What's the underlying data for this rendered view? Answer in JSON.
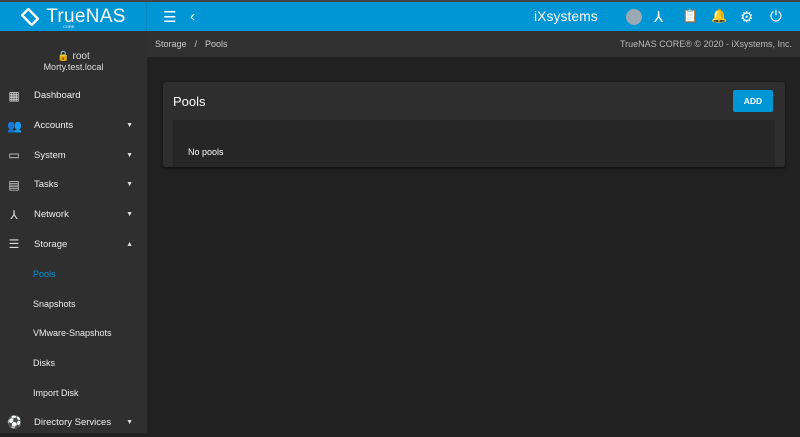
{
  "topbar": {
    "brand": "TrueNAS",
    "brand_sub": "CORE",
    "vendor_logo": "iXsystems",
    "icons": [
      "menu-icon",
      "chevron-left-icon",
      "truecommand-icon",
      "network-icon",
      "tasks-clipboard-icon",
      "bell-icon",
      "gear-icon",
      "power-icon"
    ]
  },
  "user": {
    "name": "root",
    "host": "Morty.test.local"
  },
  "sidebar": {
    "items": [
      {
        "label": "Dashboard",
        "icon": "▦"
      },
      {
        "label": "Accounts",
        "icon": "👥",
        "expandable": true
      },
      {
        "label": "System",
        "icon": "▭",
        "expandable": true
      },
      {
        "label": "Tasks",
        "icon": "▤",
        "expandable": true
      },
      {
        "label": "Network",
        "icon": "⅄",
        "expandable": true
      },
      {
        "label": "Storage",
        "icon": "☰",
        "expanded": true
      },
      {
        "label": "Pools",
        "sub": true,
        "active": true
      },
      {
        "label": "Snapshots",
        "sub": true
      },
      {
        "label": "VMware-Snapshots",
        "sub": true
      },
      {
        "label": "Disks",
        "sub": true
      },
      {
        "label": "Import Disk",
        "sub": true
      },
      {
        "label": "Directory Services",
        "icon": "⚽",
        "expandable": true
      }
    ]
  },
  "breadcrumb": {
    "items": [
      "Storage",
      "Pools"
    ],
    "separator": "/",
    "copyright": "TrueNAS CORE® © 2020 - iXsystems, Inc."
  },
  "card": {
    "title": "Pools",
    "add_label": "ADD",
    "empty_text": "No pools"
  },
  "colors": {
    "accent": "#0095d5"
  }
}
